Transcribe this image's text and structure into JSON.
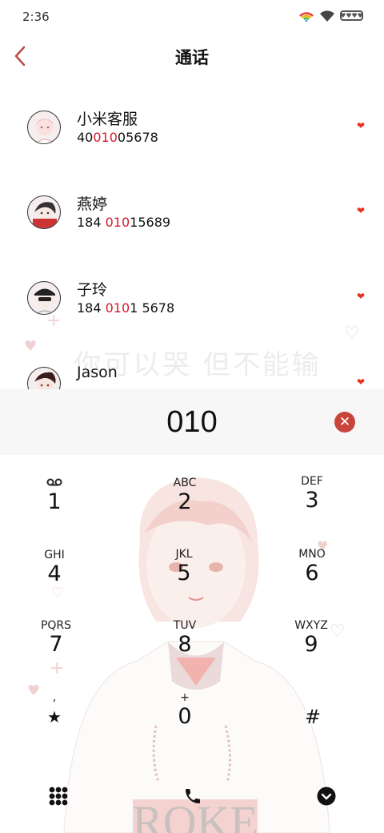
{
  "status_bar": {
    "time": "2:36",
    "battery_label": "♥♥♥♥"
  },
  "header": {
    "title": "通话",
    "back_icon": "chevron-left-icon"
  },
  "contacts": [
    {
      "name": "小米客服",
      "number_prefix": "40",
      "number_match": "010",
      "number_suffix": "05678"
    },
    {
      "name": "燕婷",
      "number_prefix": "184 ",
      "number_match": "010",
      "number_suffix": "15689"
    },
    {
      "name": "子玲",
      "number_prefix": "184 ",
      "number_match": "010",
      "number_suffix": "1 5678"
    },
    {
      "name": "Jason",
      "number_prefix": "",
      "number_match": "",
      "number_suffix": ""
    }
  ],
  "favorite_icon": "heart-icon",
  "watermark": "你可以哭 但不能输",
  "dialer": {
    "input": "010",
    "keys": [
      {
        "letters": "",
        "digit": "1",
        "icon": "voicemail-icon"
      },
      {
        "letters": "ABC",
        "digit": "2"
      },
      {
        "letters": "DEF",
        "digit": "3"
      },
      {
        "letters": "GHI",
        "digit": "4"
      },
      {
        "letters": "JKL",
        "digit": "5"
      },
      {
        "letters": "MNO",
        "digit": "6"
      },
      {
        "letters": "PQRS",
        "digit": "7"
      },
      {
        "letters": "TUV",
        "digit": "8"
      },
      {
        "letters": "WXYZ",
        "digit": "9"
      },
      {
        "letters": ",",
        "digit": "★"
      },
      {
        "letters": "+",
        "digit": "0"
      },
      {
        "letters": "",
        "digit": "#"
      }
    ],
    "bottom_icons": [
      "keypad-grid-icon",
      "phone-call-icon",
      "collapse-down-icon"
    ]
  },
  "art_text": "ROKE",
  "colors": {
    "accent": "#c8453c",
    "match": "#d81a2a",
    "heart": "#e8321f"
  }
}
